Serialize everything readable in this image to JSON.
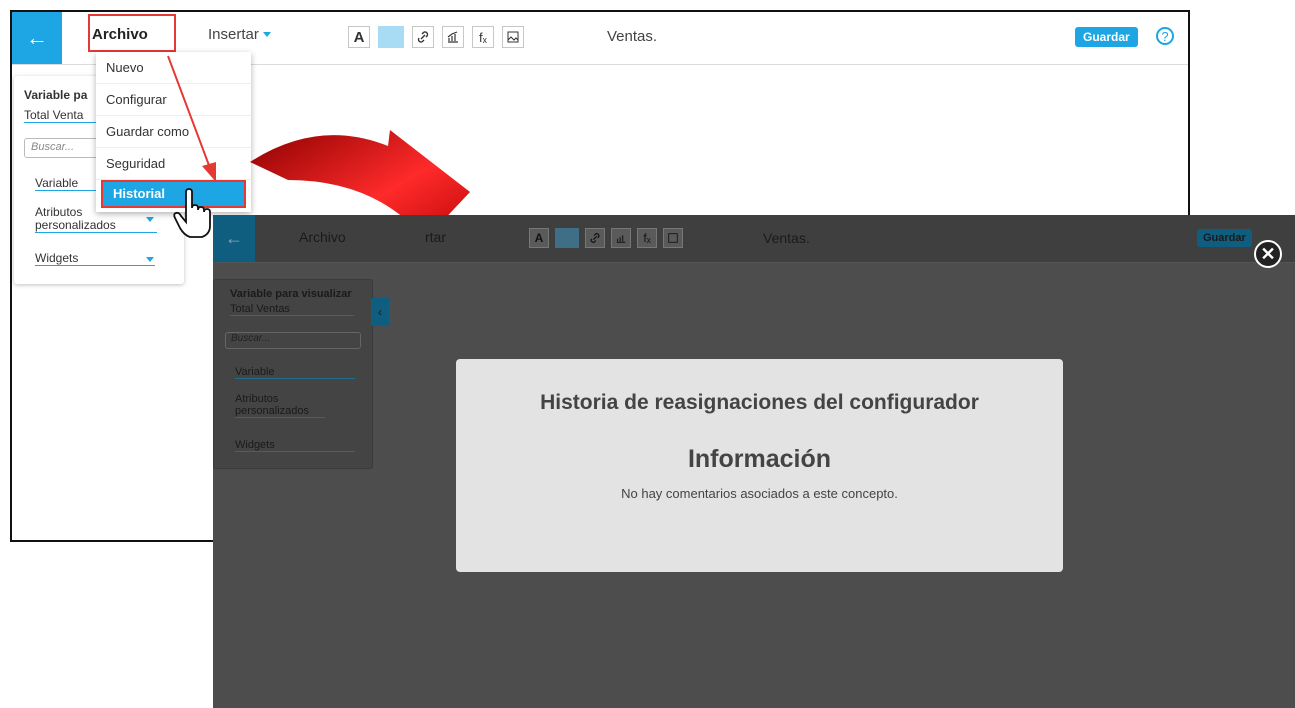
{
  "editor": {
    "back_icon": "arrow-left-icon",
    "menu_file": "Archivo",
    "menu_insert": "Insertar",
    "toolbar_icons": [
      "text-icon",
      "fill-color-icon",
      "link-icon",
      "chart-icon",
      "function-icon",
      "image-icon"
    ],
    "tool_text_glyph": "A",
    "tool_func_glyph": "fₓ",
    "page_title": "Ventas.",
    "save_label": "Guardar",
    "help_glyph": "?"
  },
  "sidebar": {
    "variable_title_cut": "Variable pa",
    "variable_value_cut": "Total Venta",
    "variable_title": "Variable para visualizar",
    "variable_value": "Total Ventas",
    "search_placeholder": "Buscar...",
    "items": [
      "Variable",
      "Atributos personalizados",
      "Widgets"
    ]
  },
  "file_menu": {
    "items": [
      "Nuevo",
      "Configurar",
      "Guardar como",
      "Seguridad",
      "Historial"
    ],
    "highlighted": "Historial"
  },
  "overlay_editor": {
    "menu_file": "Archivo",
    "menu_insert_cut": "rtar",
    "page_title": "Ventas.",
    "save_label": "Guardar",
    "collapse_glyph": "‹"
  },
  "dialog": {
    "title": "Historia de reasignaciones del configurador",
    "heading": "Información",
    "message": "No hay comentarios asociados a este concepto.",
    "close_glyph": "✕"
  },
  "colors": {
    "accent": "#1ea5e3",
    "highlight_box": "#e53935",
    "arrow": "#c40000",
    "overlay": "#4d4d4d",
    "dialog_bg": "#e3e3e3"
  }
}
